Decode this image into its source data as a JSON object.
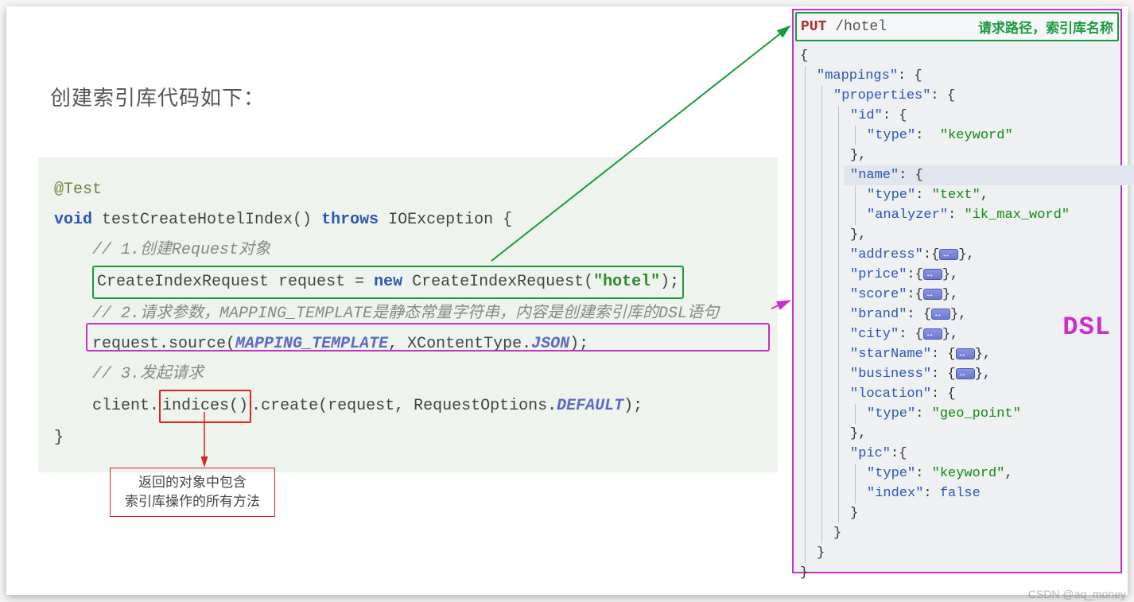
{
  "title": "创建索引库代码如下：",
  "code": {
    "anno": "@Test",
    "kw_void": "void",
    "fnname": " testCreateHotelIndex() ",
    "kw_throws": "throws",
    "exc": " IOException {",
    "c1": "// 1.创建Request对象",
    "l2a": "CreateIndexRequest request = ",
    "kw_new": "new",
    "l2b": " CreateIndexRequest(",
    "str_hotel": "\"hotel\"",
    "l2c": ");",
    "c2": "// 2.请求参数，MAPPING_TEMPLATE是静态常量字符串，内容是创建索引库的DSL语句",
    "l3a": "request.source(",
    "em_mapping": "MAPPING_TEMPLATE",
    "l3b": ", XContentType.",
    "em_json": "JSON",
    "l3c": ");",
    "c3": "// 3.发起请求",
    "l4a": "client.",
    "indices": "indices()",
    "l4b": ".create(request, RequestOptions.",
    "em_default": "DEFAULT",
    "l4c": ");",
    "close": "}"
  },
  "callout": {
    "line1": "返回的对象中包含",
    "line2": "索引库操作的所有方法"
  },
  "dsl": {
    "put": "PUT",
    "path": " /hotel",
    "hdr_lbl": "请求路径，索引库名称",
    "dsl_label": "DSL",
    "keys": {
      "mappings": "\"mappings\"",
      "properties": "\"properties\"",
      "id": "\"id\"",
      "type": "\"type\"",
      "name": "\"name\"",
      "analyzer": "\"analyzer\"",
      "address": "\"address\"",
      "price": "\"price\"",
      "score": "\"score\"",
      "brand": "\"brand\"",
      "city": "\"city\"",
      "starName": "\"starName\"",
      "business": "\"business\"",
      "location": "\"location\"",
      "pic": "\"pic\"",
      "index": "\"index\""
    },
    "vals": {
      "keyword": "\"keyword\"",
      "text": "\"text\"",
      "ik": "\"ik_max_word\"",
      "geo": "\"geo_point\"",
      "false": "false"
    }
  },
  "watermark": "CSDN @aq_money"
}
